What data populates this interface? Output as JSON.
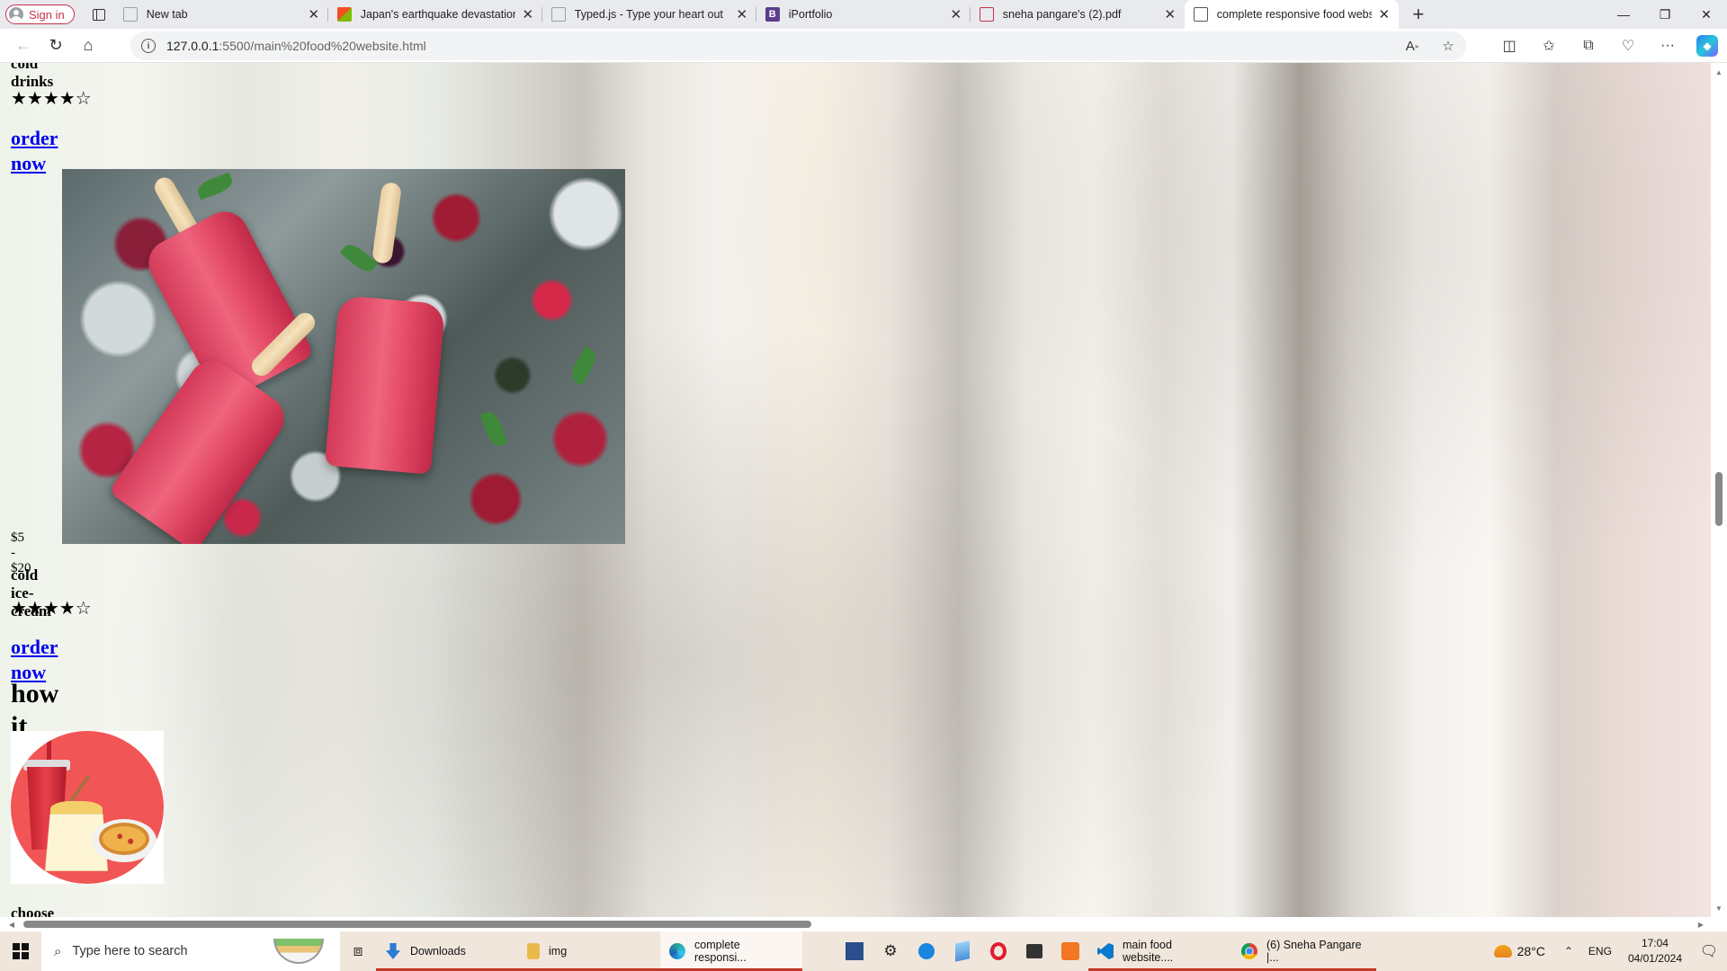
{
  "browser": {
    "sign_in_label": "Sign in",
    "tabs": [
      {
        "title": "New tab",
        "favicon_color": "#9aa0a6"
      },
      {
        "title": "Japan's earthquake devastation c",
        "favicon_color": "#f2b233"
      },
      {
        "title": "Typed.js - Type your heart out",
        "favicon_color": "#9aa0a6"
      },
      {
        "title": "iPortfolio",
        "favicon_color": "#5a3e8c"
      },
      {
        "title": "sneha pangare's (2).pdf",
        "favicon_color": "#c4314b"
      },
      {
        "title": "complete responsive food websi",
        "favicon_color": "#9aa0a6"
      }
    ],
    "url_host": "127.0.0.1",
    "url_path": ":5500/main%20food%20website.html"
  },
  "page": {
    "drink_title": "cold drinks",
    "drink_rating": "★★★★☆",
    "drink_order_label": "order now",
    "icecream_price": "$5 - $20",
    "icecream_title": "cold ice-cream",
    "icecream_rating": "★★★★☆",
    "icecream_order_label": "order now",
    "section_heading": "how it works",
    "step1_title": "choose your favorite food"
  },
  "taskbar": {
    "search_placeholder": "Type here to search",
    "apps": [
      {
        "label": "Downloads",
        "icon_color": "#2b7cd3"
      },
      {
        "label": "img",
        "icon_color": "#e9b949"
      },
      {
        "label": "complete responsi...",
        "icon_color": "#2aa198"
      },
      {
        "label": "main food website....",
        "icon_color": "#0a7acc"
      },
      {
        "label": "(6) Sneha Pangare |...",
        "icon_color": "#db4437"
      }
    ],
    "temperature": "28°C",
    "language": "ENG",
    "time": "17:04",
    "date": "04/01/2024"
  }
}
